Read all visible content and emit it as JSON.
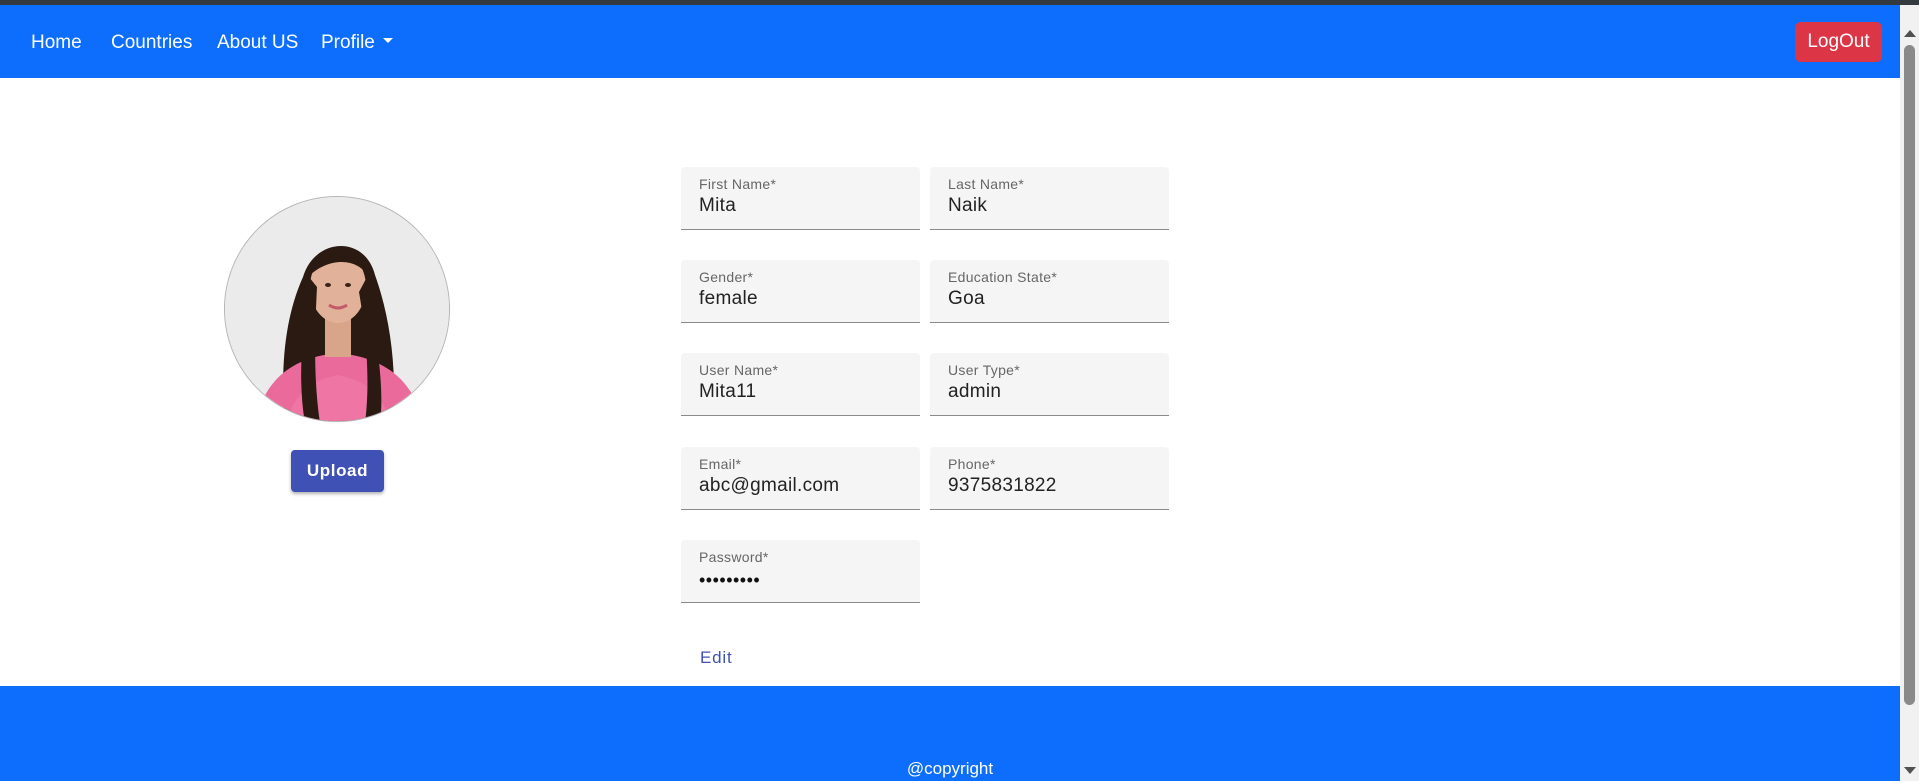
{
  "navbar": {
    "links": [
      {
        "label": "Home"
      },
      {
        "label": "Countries"
      },
      {
        "label": "About US"
      },
      {
        "label": "Profile"
      }
    ],
    "logout_label": "LogOut"
  },
  "profile": {
    "upload_label": "Upload"
  },
  "form": {
    "first_name": {
      "label": "First Name*",
      "value": "Mita"
    },
    "last_name": {
      "label": "Last Name*",
      "value": "Naik"
    },
    "gender": {
      "label": "Gender*",
      "value": "female"
    },
    "education_state": {
      "label": "Education State*",
      "value": "Goa"
    },
    "user_name": {
      "label": "User Name*",
      "value": "Mita11"
    },
    "user_type": {
      "label": "User Type*",
      "value": "admin"
    },
    "email": {
      "label": "Email*",
      "value": "abc@gmail.com"
    },
    "phone": {
      "label": "Phone*",
      "value": "9375831822"
    },
    "password": {
      "label": "Password*",
      "value": "•••••••••"
    },
    "edit_label": "Edit"
  },
  "footer": {
    "copyright": "@copyright"
  },
  "colors": {
    "primary": "#0d6efd",
    "danger": "#dc3545",
    "indigo": "#3f51b5"
  },
  "icons": {
    "dropdown": "caret-down-icon",
    "avatar": "user-photo"
  }
}
